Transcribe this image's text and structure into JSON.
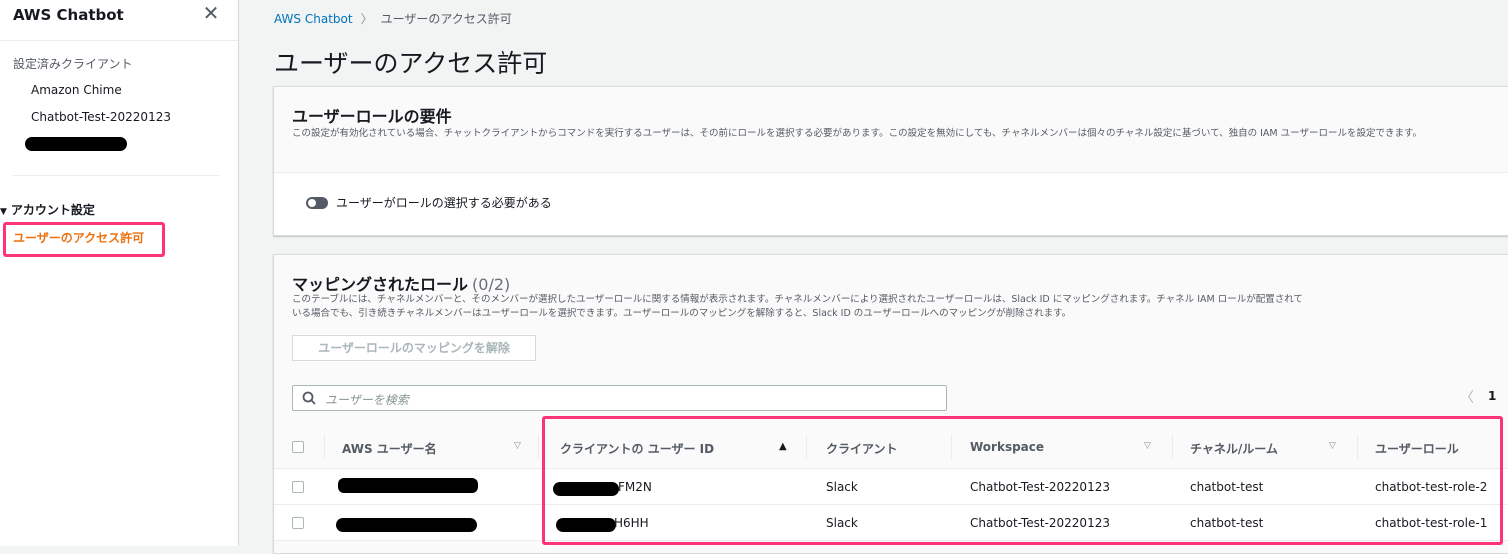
{
  "sidebar": {
    "title": "AWS Chatbot",
    "close_icon": "close-icon",
    "section_label": "設定済みクライアント",
    "clients": [
      "Amazon Chime",
      "Chatbot-Test-20220123"
    ],
    "account_settings": "アカウント設定",
    "active_item": "ユーザーのアクセス許可"
  },
  "breadcrumb": {
    "root": "AWS Chatbot",
    "current": "ユーザーのアクセス許可"
  },
  "page_title": "ユーザーのアクセス許可",
  "role_requirement": {
    "title": "ユーザーロールの要件",
    "description": "この設定が有効化されている場合、チャットクライアントからコマンドを実行するユーザーは、その前にロールを選択する必要があります。この設定を無効にしても、チャネルメンバーは個々のチャネル設定に基づいて、独自の IAM ユーザーロールを設定できます。",
    "toggle_label": "ユーザーがロールの選択する必要がある",
    "toggle_on": false
  },
  "mapped_roles": {
    "title": "マッピングされたロール",
    "count": "(0/2)",
    "description": "このテーブルには、チャネルメンバーと、そのメンバーが選択したユーザーロールに関する情報が表示されます。チャネルメンバーにより選択されたユーザーロールは、Slack ID にマッピングされます。チャネル IAM ロールが配置されている場合でも、引き続きチャネルメンバーはユーザーロールを選択できます。ユーザーロールのマッピングを解除すると、Slack ID のユーザーロールへのマッピングが削除されます。",
    "unmap_button": "ユーザーロールのマッピングを解除",
    "search_placeholder": "ユーザーを検索",
    "page_number": "1",
    "columns": [
      "AWS ユーザー名",
      "クライアントの ユーザー ID",
      "クライアント",
      "Workspace",
      "チャネル/ルーム",
      "ユーザーロール"
    ],
    "rows": [
      {
        "user_id_suffix": "FM2N",
        "client": "Slack",
        "workspace": "Chatbot-Test-20220123",
        "channel": "chatbot-test",
        "role": "chatbot-test-role-2"
      },
      {
        "user_id_suffix": "H6HH",
        "client": "Slack",
        "workspace": "Chatbot-Test-20220123",
        "channel": "chatbot-test",
        "role": "chatbot-test-role-1"
      }
    ]
  },
  "colors": {
    "accent_active": "#ec7211",
    "link": "#0073bb",
    "annotation": "#ff3377"
  }
}
